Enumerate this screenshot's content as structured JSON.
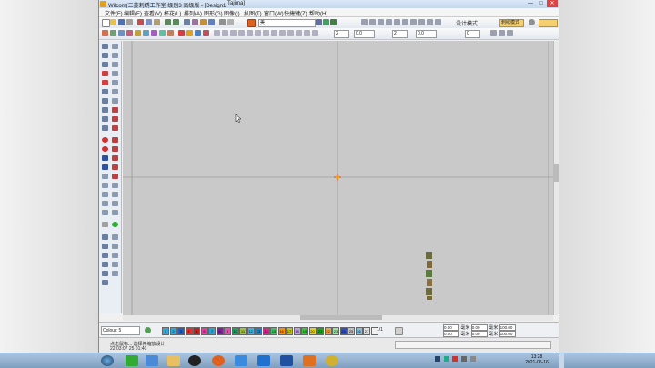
{
  "window": {
    "title": "Wilcom(三菱刺绣工作室  级别3 高级版 - [Design1",
    "title_tail": "Tajima]",
    "minimize": "—",
    "maximize": "□",
    "close": "✕"
  },
  "menu": [
    "文件(F)",
    "编辑(E)",
    "查看(V)",
    "杯花(L)",
    "排列(A)",
    "图形(G)",
    "图像(I)",
    "扒图(T)",
    "窗口(W)",
    "快捷键(Z)",
    "帮助(H)"
  ],
  "toolbar": {
    "font_field": "美",
    "design_mode_label": "设计模式：",
    "design_mode_button": "刺绣模式",
    "spin_values": [
      "2",
      "0.0",
      "2",
      "0.0",
      "0"
    ]
  },
  "status": {
    "colour_label": "Colour: 5",
    "swatch_colors": [
      "#2fa8d8",
      "#2fa8d8",
      "#2060c0",
      "#e03030",
      "#c02020",
      "#e040a0",
      "#30a0d0",
      "#8020a0",
      "#e050b0",
      "#20a060",
      "#a0c040",
      "#40b0e0",
      "#2080c0",
      "#e02090",
      "#40c060",
      "#ff8c00",
      "#c0c020",
      "#c0a0e0",
      "#40c040",
      "#e0d020",
      "#20a020",
      "#f0a040",
      "#a0e0a0",
      "#3050c0",
      "#c0c0c0",
      "#80c0e0",
      "#e0e0e0",
      "#f0f0f0"
    ],
    "swatch_labels": [
      "1",
      "2",
      "3",
      "4",
      "5",
      "6",
      "7",
      "8",
      "9",
      "10",
      "11",
      "12",
      "13",
      "14",
      "15",
      "16",
      "17",
      "18",
      "19",
      "20",
      "21",
      "22",
      "23",
      "24",
      "25",
      "26",
      "27"
    ],
    "counter": "1/1",
    "coords": {
      "x": "0.00",
      "y": "0.00",
      "w": "0.00",
      "h": "0.00",
      "unit": "毫米",
      "pct1": "100.00",
      "pct2": "100.00"
    },
    "lower_hint": "点击鼠标... 选择并缩放设计"
  },
  "taskbar": {
    "time": "13:28",
    "date": "2021-06-16",
    "left_label": "22 03:07 25 01:40"
  },
  "colors": {
    "canvas": "#c9c9c9",
    "guide_line": "#8a8a8a",
    "origin_mark": "#e04040"
  }
}
